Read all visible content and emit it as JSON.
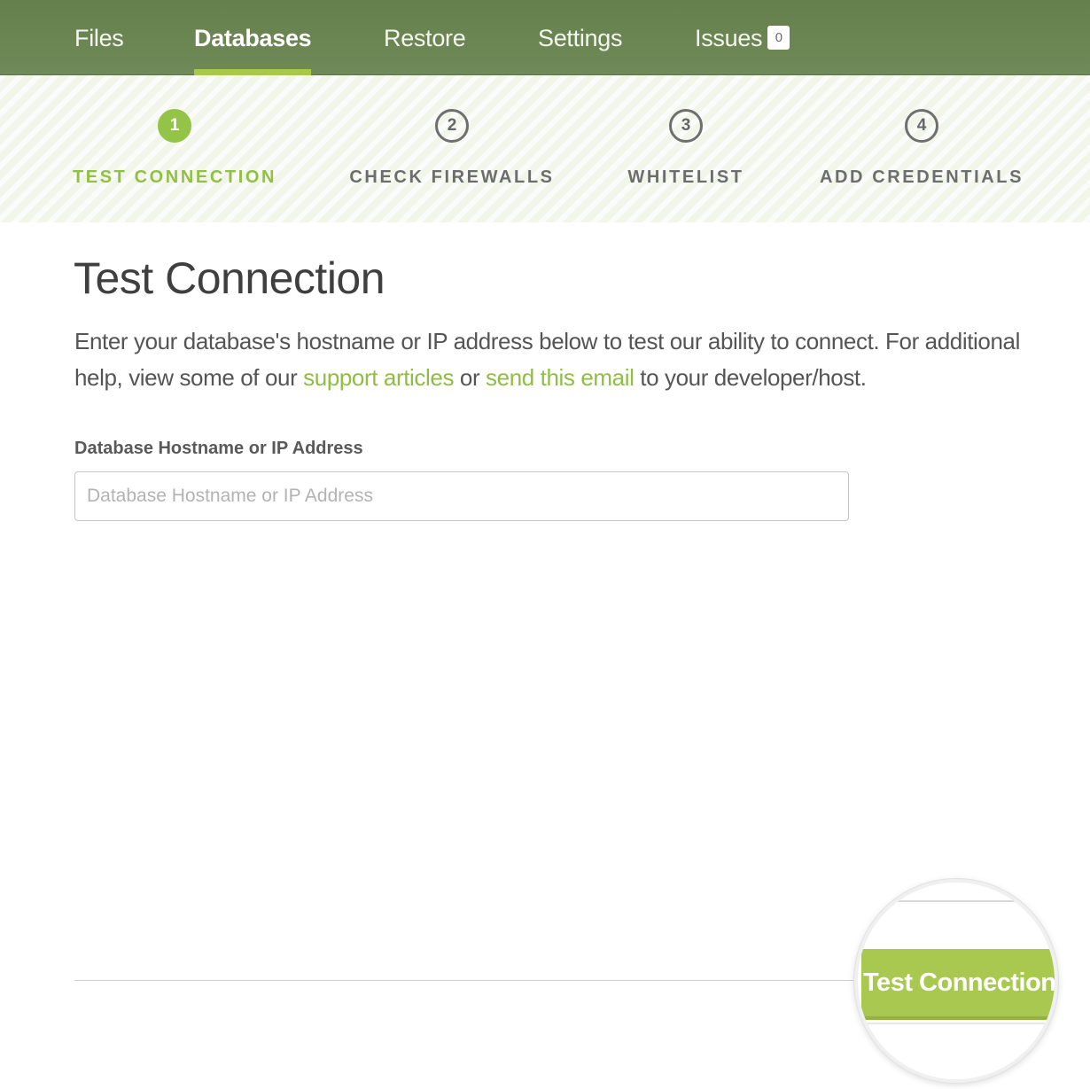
{
  "nav": {
    "tabs": [
      {
        "label": "Files"
      },
      {
        "label": "Databases"
      },
      {
        "label": "Restore"
      },
      {
        "label": "Settings"
      },
      {
        "label": "Issues"
      }
    ],
    "issues_count": "0",
    "active_tab": "Databases",
    "accent_color": "#a7c84b",
    "bar_color": "#6b854f"
  },
  "steps": [
    {
      "number": "1",
      "label": "TEST CONNECTION"
    },
    {
      "number": "2",
      "label": "CHECK FIREWALLS"
    },
    {
      "number": "3",
      "label": "WHITELIST"
    },
    {
      "number": "4",
      "label": "ADD CREDENTIALS"
    }
  ],
  "main": {
    "title": "Test Connection",
    "intro_before": "Enter your database's hostname or IP address below to test our ability to connect. For additional help, view some of our ",
    "link_support": "support articles",
    "intro_middle": " or ",
    "link_email": "send this email",
    "intro_after": " to your developer/host.",
    "field_label": "Database Hostname or IP Address",
    "field_placeholder": "Database Hostname or IP Address",
    "field_value": ""
  },
  "actions": {
    "test_button_label": "Test Connection",
    "button_color": "#a8c84f"
  }
}
